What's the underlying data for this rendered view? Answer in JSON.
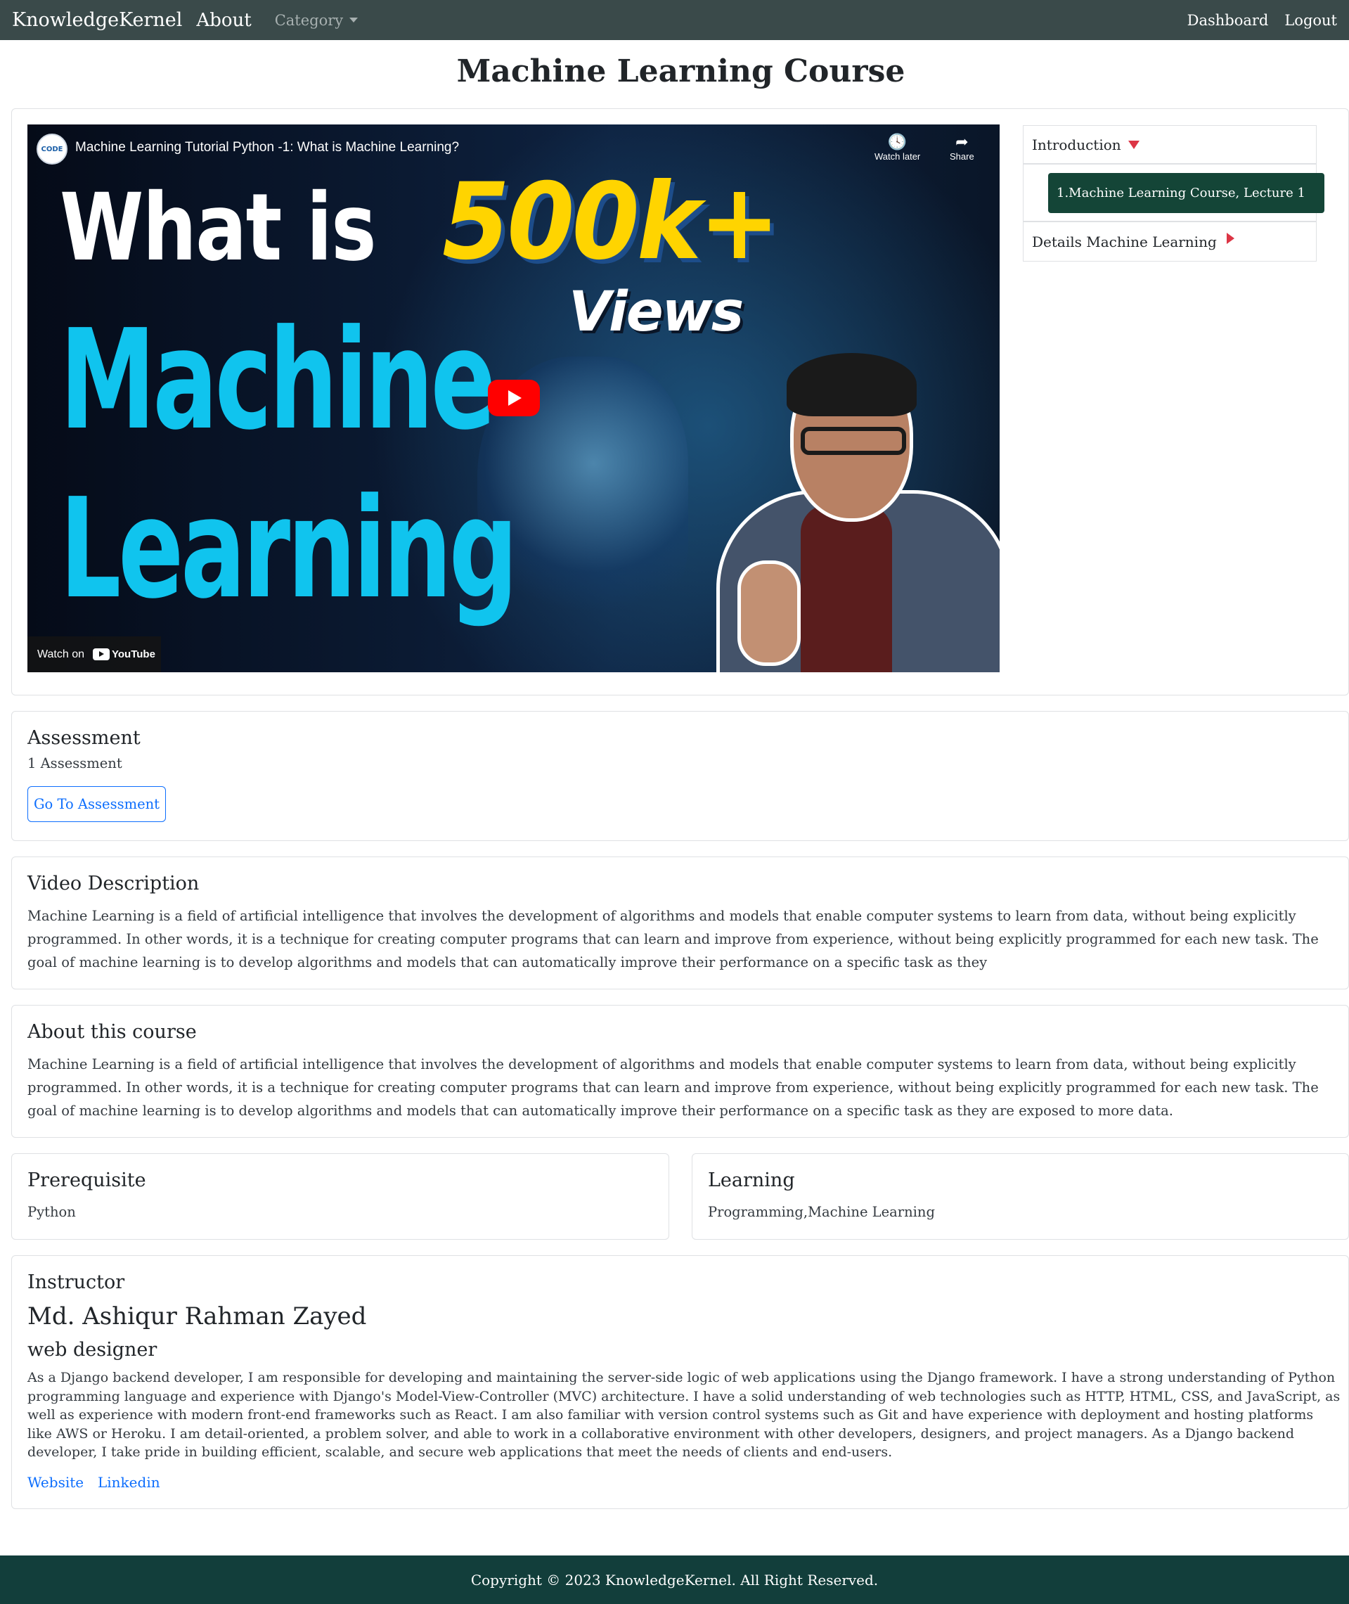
{
  "navbar": {
    "brand": "KnowledgeKernel",
    "about": "About",
    "category": "Category",
    "dashboard": "Dashboard",
    "logout": "Logout"
  },
  "page": {
    "title": "Machine Learning Course"
  },
  "video": {
    "channel_badge": "CODE",
    "title": "Machine Learning Tutorial Python -1: What is Machine Learning?",
    "watch_later": "Watch later",
    "share": "Share",
    "thumb_line1": "What is",
    "thumb_line2": "Machine",
    "thumb_line3": "Learning",
    "thumb_badge": "500k+",
    "thumb_views": "Views",
    "watch_on": "Watch on",
    "youtube": "YouTube"
  },
  "playlist": {
    "section": "Introduction",
    "active_lecture": "1.Machine Learning Course, Lecture 1",
    "next_section": "Details Machine Learning"
  },
  "assessment": {
    "heading": "Assessment",
    "count": "1 Assessment",
    "button": "Go To Assessment"
  },
  "description": {
    "heading": "Video Description",
    "text": "Machine Learning is a field of artificial intelligence that involves the development of algorithms and models that enable computer systems to learn from data, without being explicitly programmed. In other words, it is a technique for creating computer programs that can learn and improve from experience, without being explicitly programmed for each new task. The goal of machine learning is to develop algorithms and models that can automatically improve their performance on a specific task as they"
  },
  "about_course": {
    "heading": "About this course",
    "text": "Machine Learning is a field of artificial intelligence that involves the development of algorithms and models that enable computer systems to learn from data, without being explicitly programmed. In other words, it is a technique for creating computer programs that can learn and improve from experience, without being explicitly programmed for each new task. The goal of machine learning is to develop algorithms and models that can automatically improve their performance on a specific task as they are exposed to more data."
  },
  "prerequisite": {
    "heading": "Prerequisite",
    "value": "Python"
  },
  "learning": {
    "heading": "Learning",
    "value": "Programming,Machine Learning"
  },
  "instructor": {
    "heading": "Instructor",
    "name": "Md. Ashiqur Rahman Zayed",
    "role": "web designer",
    "bio": "As a Django backend developer, I am responsible for developing and maintaining the server-side logic of web applications using the Django framework. I have a strong understanding of Python programming language and experience with Django's Model-View-Controller (MVC) architecture. I have a solid understanding of web technologies such as HTTP, HTML, CSS, and JavaScript, as well as experience with modern front-end frameworks such as React. I am also familiar with version control systems such as Git and have experience with deployment and hosting platforms like AWS or Heroku. I am detail-oriented, a problem solver, and able to work in a collaborative environment with other developers, designers, and project managers. As a Django backend developer, I take pride in building efficient, scalable, and secure web applications that meet the needs of clients and end-users.",
    "website": "Website",
    "linkedin": "Linkedin"
  },
  "footer": {
    "copyright": "Copyright © 2023 KnowledgeKernel. All Right Reserved."
  }
}
